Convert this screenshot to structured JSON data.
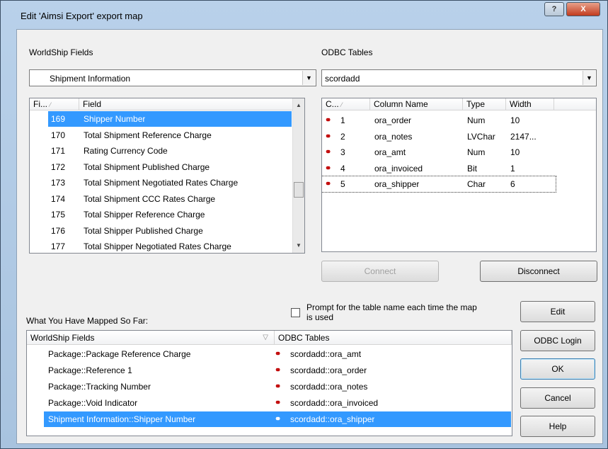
{
  "window": {
    "title": "Edit 'Aimsi Export' export map",
    "help_glyph": "?",
    "close_glyph": "X"
  },
  "worldship": {
    "label": "WorldShip Fields",
    "selected": "Shipment Information",
    "columns": [
      "Fi...",
      "Field"
    ],
    "rows": [
      {
        "num": "169",
        "name": "Shipper Number",
        "linked": true
      },
      {
        "num": "170",
        "name": "Total Shipment Reference Charge",
        "linked": false
      },
      {
        "num": "171",
        "name": "Rating Currency Code",
        "linked": false
      },
      {
        "num": "172",
        "name": "Total Shipment Published Charge",
        "linked": false
      },
      {
        "num": "173",
        "name": "Total Shipment Negotiated Rates Charge",
        "linked": false
      },
      {
        "num": "174",
        "name": "Total Shipment CCC Rates Charge",
        "linked": false
      },
      {
        "num": "175",
        "name": "Total Shipper Reference Charge",
        "linked": false
      },
      {
        "num": "176",
        "name": "Total Shipper Published Charge",
        "linked": false
      },
      {
        "num": "177",
        "name": "Total Shipper Negotiated Rates Charge",
        "linked": false
      }
    ]
  },
  "odbc": {
    "label": "ODBC Tables",
    "selected": "scordadd",
    "columns": [
      "C...",
      "Column Name",
      "Type",
      "Width"
    ],
    "rows": [
      {
        "num": "1",
        "name": "ora_order",
        "type": "Num",
        "width": "10"
      },
      {
        "num": "2",
        "name": "ora_notes",
        "type": "LVChar",
        "width": "2147..."
      },
      {
        "num": "3",
        "name": "ora_amt",
        "type": "Num",
        "width": "10"
      },
      {
        "num": "4",
        "name": "ora_invoiced",
        "type": "Bit",
        "width": "1"
      },
      {
        "num": "5",
        "name": "ora_shipper",
        "type": "Char",
        "width": "6"
      }
    ]
  },
  "buttons": {
    "connect": "Connect",
    "disconnect": "Disconnect",
    "edit": "Edit",
    "odbc_login": "ODBC Login",
    "ok": "OK",
    "cancel": "Cancel",
    "help": "Help"
  },
  "prompt_checkbox": {
    "label_line1": "Prompt for the table name each time the map",
    "label_line2": "is used",
    "checked": false
  },
  "mapped": {
    "label": "What You Have Mapped So Far:",
    "columns": [
      "WorldShip Fields",
      "ODBC Tables"
    ],
    "rows": [
      {
        "ws": "Package::Package Reference Charge",
        "odbc": "scordadd::ora_amt"
      },
      {
        "ws": "Package::Reference 1",
        "odbc": "scordadd::ora_order"
      },
      {
        "ws": "Package::Tracking Number",
        "odbc": "scordadd::ora_notes"
      },
      {
        "ws": "Package::Void Indicator",
        "odbc": "scordadd::ora_invoiced"
      },
      {
        "ws": "Shipment Information::Shipper Number",
        "odbc": "scordadd::ora_shipper"
      }
    ]
  },
  "icons": {
    "link": "link-icon",
    "dropdown": "chevron-down-icon",
    "sort": "sort-icon",
    "filter": "filter-icon"
  },
  "colors": {
    "selection": "#3399ff",
    "link": "#c00000"
  }
}
